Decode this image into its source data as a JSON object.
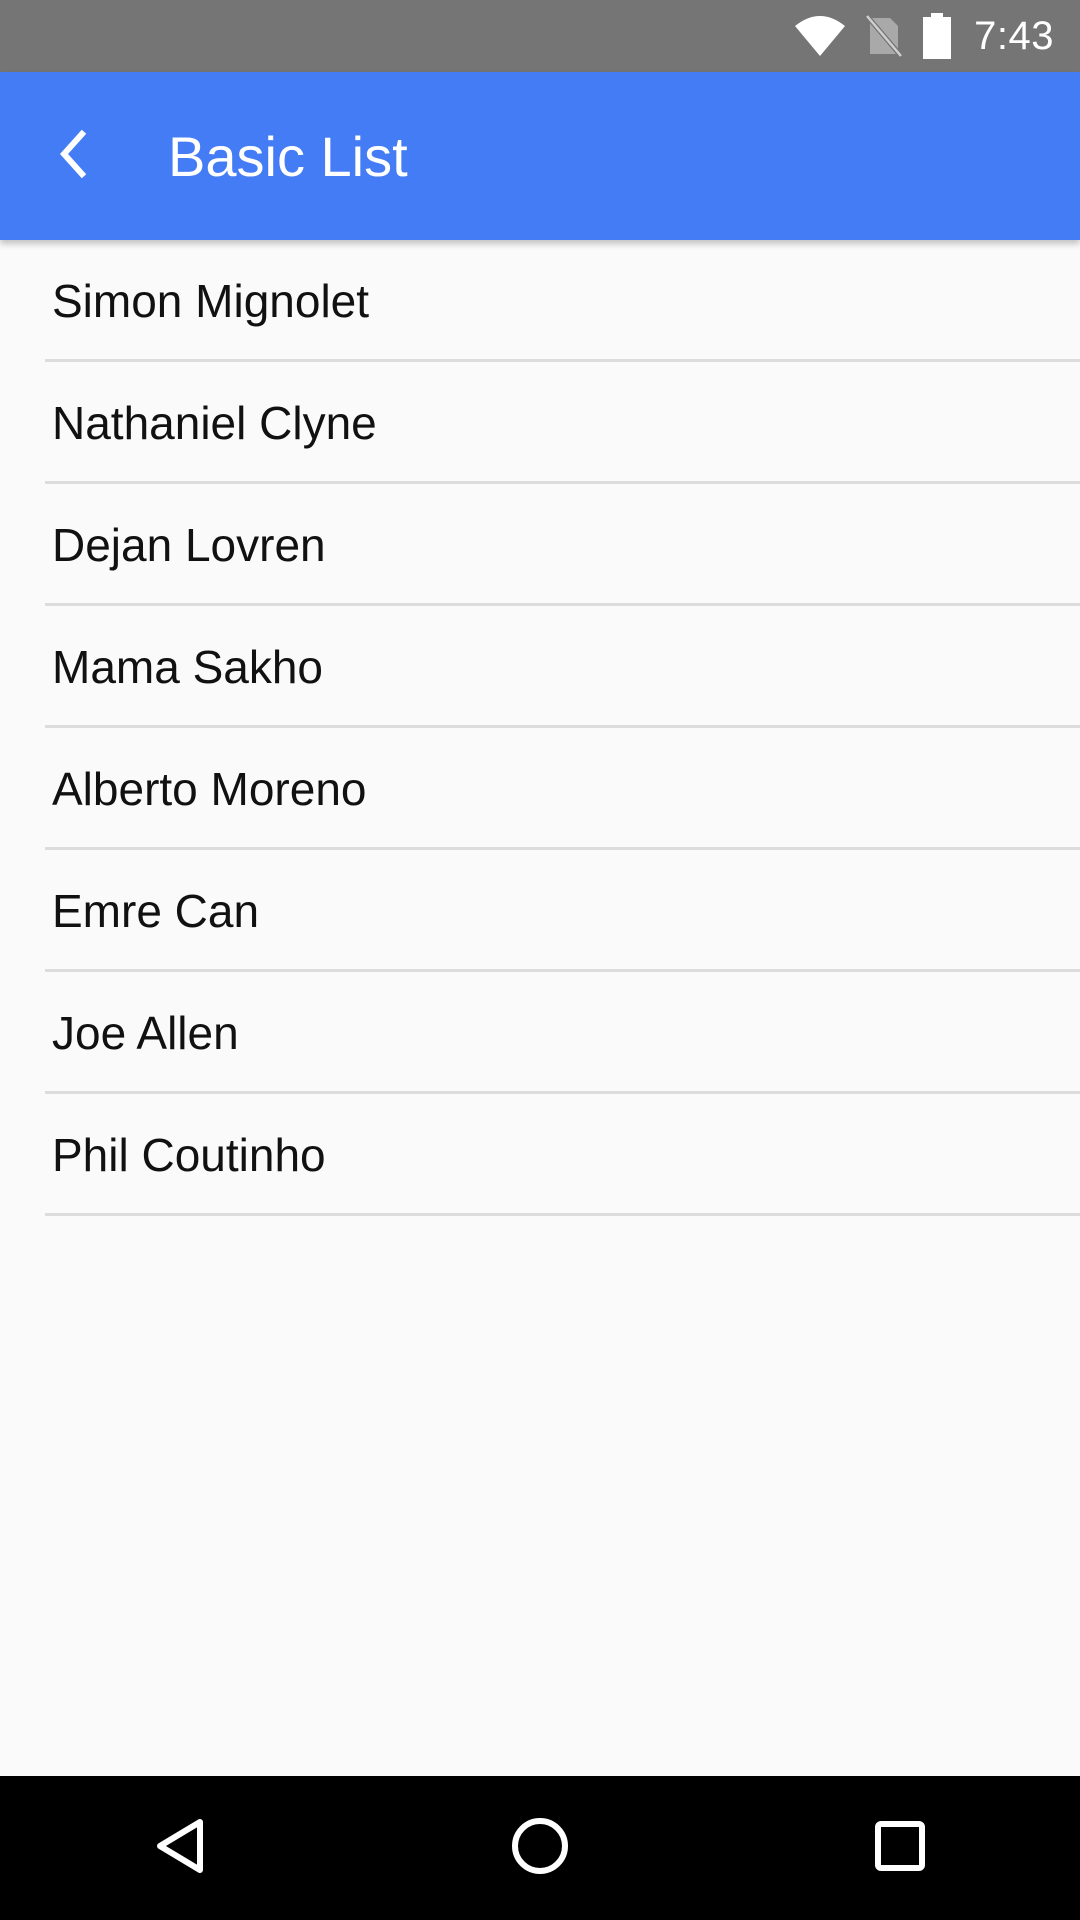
{
  "status_bar": {
    "time": "7:43",
    "icons": [
      "wifi-icon",
      "no-sim-icon",
      "battery-icon"
    ]
  },
  "app_bar": {
    "back_icon": "chevron-left-icon",
    "title": "Basic List",
    "background_color": "#447cf5"
  },
  "list": {
    "items": [
      "Simon Mignolet",
      "Nathaniel Clyne",
      "Dejan Lovren",
      "Mama Sakho",
      "Alberto Moreno",
      "Emre Can",
      "Joe Allen",
      "Phil Coutinho"
    ]
  },
  "nav_bar": {
    "buttons": [
      "back-triangle-icon",
      "home-circle-icon",
      "recents-square-icon"
    ]
  }
}
